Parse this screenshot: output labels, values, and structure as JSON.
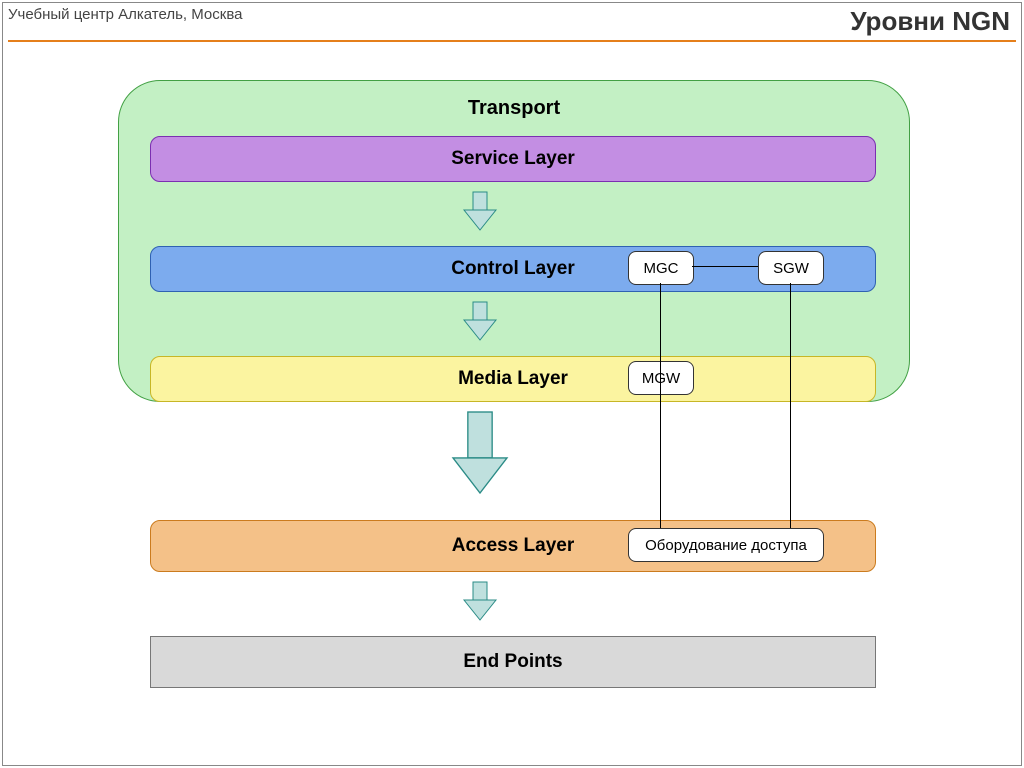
{
  "header": {
    "left": "Учебный центр Алкатель, Москва",
    "right": "Уровни NGN"
  },
  "transport": {
    "title": "Transport"
  },
  "layers": {
    "service": "Service Layer",
    "control": "Control Layer",
    "media": "Media Layer",
    "access": "Access Layer",
    "endpoints": "End Points"
  },
  "nodes": {
    "mgc": "MGC",
    "sgw": "SGW",
    "mgw": "MGW",
    "access_eq": "Оборудование доступа"
  }
}
